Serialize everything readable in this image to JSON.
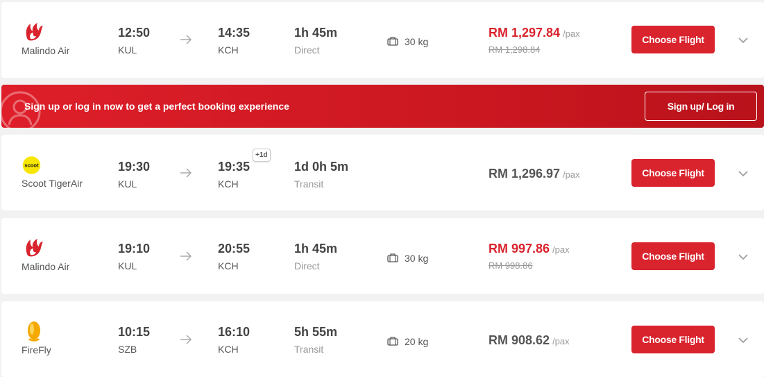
{
  "flights": [
    {
      "airline": "Malindo Air",
      "logo_icon": "malindo-logo",
      "dep_time": "12:50",
      "dep_code": "KUL",
      "arr_time": "14:35",
      "arr_code": "KCH",
      "plus_day": "",
      "duration": "1h 45m",
      "stops": "Direct",
      "baggage": "30 kg",
      "price": "RM 1,297.84",
      "pax": "/pax",
      "old_price": "RM 1,298.84",
      "price_color": "#d9232d"
    },
    {
      "airline": "Scoot TigerAir",
      "logo_icon": "scoot-logo",
      "logo_text": "scoot",
      "dep_time": "19:30",
      "dep_code": "KUL",
      "arr_time": "19:35",
      "arr_code": "KCH",
      "plus_day": "+1d",
      "duration": "1d 0h 5m",
      "stops": "Transit",
      "baggage": "",
      "price": "RM 1,296.97",
      "pax": "/pax",
      "old_price": "",
      "price_color": "#555555"
    },
    {
      "airline": "Malindo Air",
      "logo_icon": "malindo-logo",
      "dep_time": "19:10",
      "dep_code": "KUL",
      "arr_time": "20:55",
      "arr_code": "KCH",
      "plus_day": "",
      "duration": "1h 45m",
      "stops": "Direct",
      "baggage": "30 kg",
      "price": "RM 997.86",
      "pax": "/pax",
      "old_price": "RM 998.86",
      "price_color": "#d9232d"
    },
    {
      "airline": "FireFly",
      "logo_icon": "firefly-logo",
      "dep_time": "10:15",
      "dep_code": "SZB",
      "arr_time": "16:10",
      "arr_code": "KCH",
      "plus_day": "",
      "duration": "5h 55m",
      "stops": "Transit",
      "baggage": "20 kg",
      "price": "RM 908.62",
      "pax": "/pax",
      "old_price": "",
      "price_color": "#555555"
    }
  ],
  "choose_label": "Choose Flight",
  "banner": {
    "text": "Sign up or log in now to get a perfect booking experience",
    "button": "Sign up/ Log in",
    "icon": "user-icon"
  },
  "colors": {
    "brand_red": "#d9232d",
    "page_bg": "#f2f2f2"
  }
}
